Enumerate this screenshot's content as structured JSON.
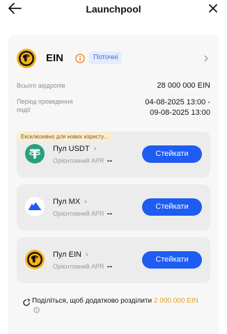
{
  "header": {
    "title": "Launchpool",
    "back_icon": "arrow-left-icon",
    "close_icon": "close-icon"
  },
  "project": {
    "token": "EIN",
    "status_badge": "Поточні",
    "total_airdrop_label": "Всього аірдропів",
    "total_airdrop_value": "28 000 000 EIN",
    "period_label_line1": "Період проведення",
    "period_label_line2": "події",
    "period_value_line1": "04-08-2025 13:00 -",
    "period_value_line2": "09-08-2025 13:00"
  },
  "pools": [
    {
      "tag": "Ексклюзивно для нових користу...",
      "name": "Пул USDT",
      "apr_label": "Орієнтовний APR",
      "apr_value": "--",
      "button": "Стейкати",
      "icon": "usdt-logo-icon"
    },
    {
      "name": "Пул MX",
      "apr_label": "Орієнтовний APR",
      "apr_value": "--",
      "button": "Стейкати",
      "icon": "mx-logo-icon"
    },
    {
      "name": "Пул EIN",
      "apr_label": "Орієнтовний APR",
      "apr_value": "--",
      "button": "Стейкати",
      "icon": "ein-logo-icon"
    }
  ],
  "share": {
    "text": "Поділіться, щоб додатково розділити",
    "amount": "2 000 000 EIN"
  },
  "colors": {
    "accent_blue": "#1e5cf2",
    "usdt_green": "#26a17b",
    "highlight_gold": "#e0a21b",
    "info_orange": "#f07d1e"
  }
}
